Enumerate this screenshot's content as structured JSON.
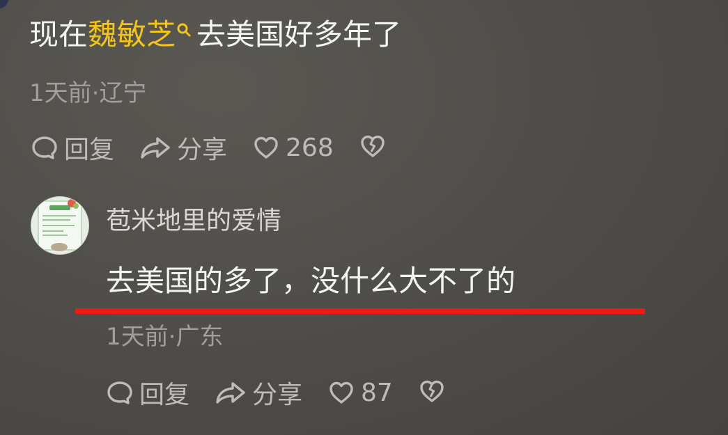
{
  "top_comment": {
    "prefix": "现在",
    "keyword": "魏敏芝",
    "keyword_icon": "search-icon",
    "suffix": "去美国好多年了",
    "time": "1天前",
    "separator": "·",
    "location": "辽宁",
    "reply_label": "回复",
    "share_label": "分享",
    "like_count": "268"
  },
  "reply_comment": {
    "username": "苞米地里的爱情",
    "text": "去美国的多了，没什么大不了的",
    "time": "1天前",
    "separator": "·",
    "location": "广东",
    "reply_label": "回复",
    "share_label": "分享",
    "like_count": "87"
  },
  "colors": {
    "keyword": "#f3c515",
    "underline": "#f01b10",
    "meta": "#a09f9c",
    "action": "#bdbcb8"
  },
  "icons": {
    "reply": "comment-bubble-icon",
    "share": "share-arrow-icon",
    "like": "heart-icon",
    "dislike": "broken-heart-icon"
  }
}
